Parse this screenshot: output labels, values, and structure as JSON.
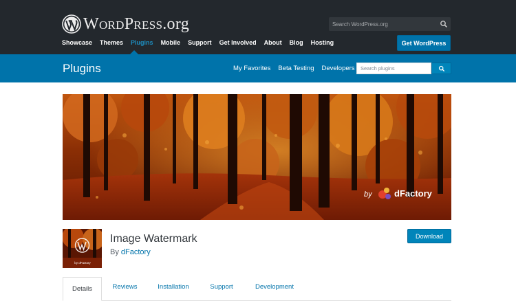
{
  "brand": {
    "wp": "WordPress",
    "org": ".org"
  },
  "global_search": {
    "placeholder": "Search WordPress.org"
  },
  "main_nav": [
    {
      "label": "Showcase"
    },
    {
      "label": "Themes"
    },
    {
      "label": "Plugins",
      "active": true
    },
    {
      "label": "Mobile"
    },
    {
      "label": "Support"
    },
    {
      "label": "Get Involved"
    },
    {
      "label": "About"
    },
    {
      "label": "Blog"
    },
    {
      "label": "Hosting"
    }
  ],
  "get_wp_label": "Get WordPress",
  "section": {
    "title": "Plugins",
    "links": [
      {
        "label": "My Favorites"
      },
      {
        "label": "Beta Testing"
      },
      {
        "label": "Developers"
      }
    ],
    "search_placeholder": "Search plugins"
  },
  "banner": {
    "by_text": "by",
    "brand_text": "dFactory"
  },
  "plugin": {
    "title": "Image Watermark",
    "author_prefix": "By",
    "author_name": "dFactory",
    "download_label": "Download",
    "thumb_text": "by dFactory"
  },
  "tabs": [
    {
      "label": "Details",
      "active": true
    },
    {
      "label": "Reviews"
    },
    {
      "label": "Installation"
    },
    {
      "label": "Support"
    },
    {
      "label": "Development"
    }
  ],
  "colors": {
    "header_dark": "#23282d",
    "header_blue": "#0073aa",
    "link_blue": "#0073aa",
    "active_nav": "#1e8cbe"
  }
}
